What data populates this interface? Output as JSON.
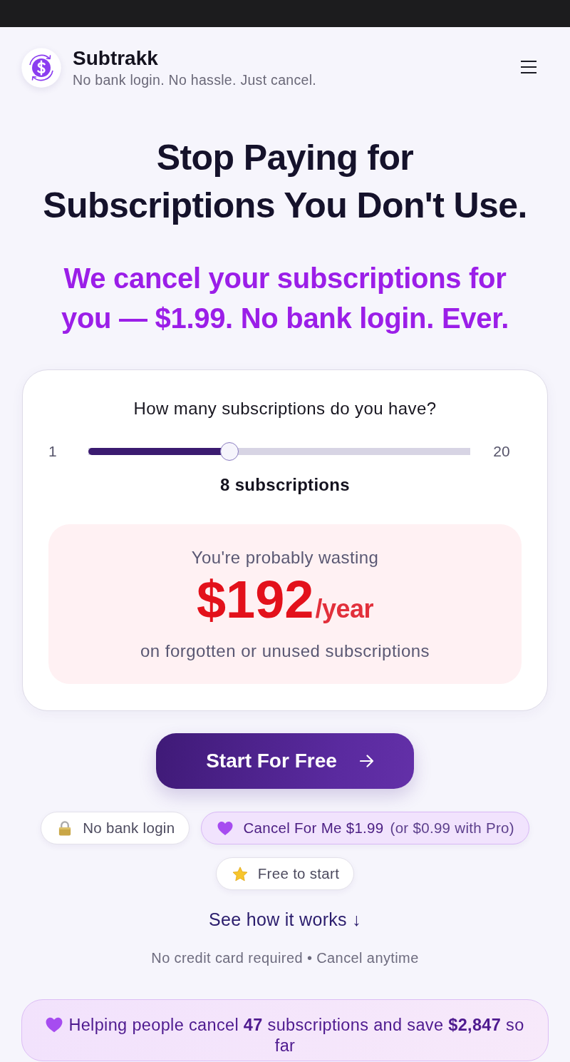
{
  "header": {
    "title": "Subtrakk",
    "tagline": "No bank login. No hassle. Just cancel."
  },
  "hero": {
    "headline": "Stop Paying for Subscriptions You Don't Use.",
    "subheadline": "We cancel your subscriptions for you — $1.99. No bank login. Ever."
  },
  "calculator": {
    "question": "How many subscriptions do you have?",
    "min_label": "1",
    "max_label": "20",
    "slider": {
      "level": 0.37
    },
    "count_label": "8 subscriptions",
    "estimate": {
      "intro": "You're probably wasting",
      "amount": "$192",
      "period": "/year",
      "caption": "on forgotten or unused subscriptions"
    }
  },
  "cta_button": {
    "label": "Start For Free"
  },
  "badges": [
    {
      "kind": "plain",
      "label": "No bank login"
    },
    {
      "kind": "accent",
      "label": "Cancel For Me $1.99",
      "note": "(or $0.99 with Pro)"
    },
    {
      "kind": "plain",
      "label": "Free to start"
    }
  ],
  "how_link": "See how it works ↓",
  "fine_print": "No credit card required • Cancel anytime",
  "stats_banner": {
    "text": "Helping people cancel **47** subscriptions and save **$2,847** so far"
  }
}
